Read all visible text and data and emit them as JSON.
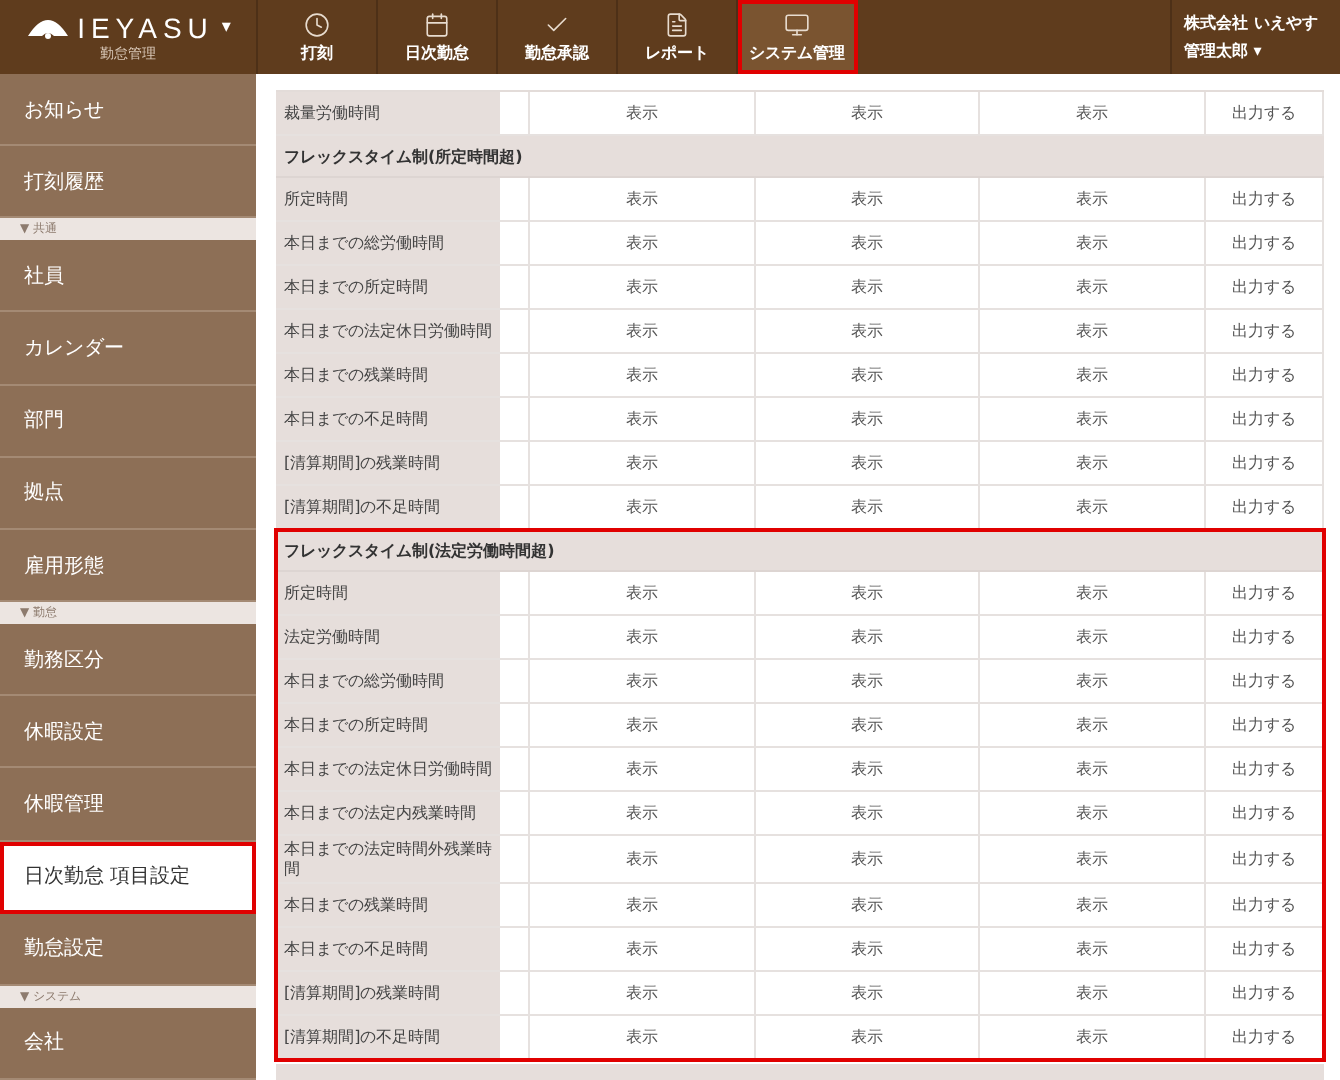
{
  "header": {
    "logo": "IEYASU",
    "logo_caret": "▾",
    "subtitle": "勤怠管理",
    "nav": [
      {
        "label": "打刻",
        "kind": "clock",
        "selected": false,
        "highlighted": false
      },
      {
        "label": "日次勤怠",
        "kind": "calendar",
        "selected": false,
        "highlighted": false
      },
      {
        "label": "勤怠承認",
        "kind": "check",
        "selected": false,
        "highlighted": false
      },
      {
        "label": "レポート",
        "kind": "document",
        "selected": false,
        "highlighted": false
      },
      {
        "label": "システム管理",
        "kind": "monitor",
        "selected": true,
        "highlighted": true
      }
    ],
    "company": "株式会社 いえやす",
    "user": "管理太郎",
    "user_caret": "▾"
  },
  "sidebar": {
    "items": [
      {
        "kind": "item",
        "label": "お知らせ",
        "selected": false,
        "highlighted": false
      },
      {
        "kind": "item",
        "label": "打刻履歴",
        "selected": false,
        "highlighted": false
      },
      {
        "kind": "group",
        "label": "▼ 共通"
      },
      {
        "kind": "item",
        "label": "社員",
        "selected": false,
        "highlighted": false
      },
      {
        "kind": "item",
        "label": "カレンダー",
        "selected": false,
        "highlighted": false
      },
      {
        "kind": "item",
        "label": "部門",
        "selected": false,
        "highlighted": false
      },
      {
        "kind": "item",
        "label": "拠点",
        "selected": false,
        "highlighted": false
      },
      {
        "kind": "item",
        "label": "雇用形態",
        "selected": false,
        "highlighted": false
      },
      {
        "kind": "group",
        "label": "▼ 勤怠"
      },
      {
        "kind": "item",
        "label": "勤務区分",
        "selected": false,
        "highlighted": false
      },
      {
        "kind": "item",
        "label": "休暇設定",
        "selected": false,
        "highlighted": false
      },
      {
        "kind": "item",
        "label": "休暇管理",
        "selected": false,
        "highlighted": false
      },
      {
        "kind": "item",
        "label": "日次勤怠 項目設定",
        "selected": true,
        "highlighted": true
      },
      {
        "kind": "item",
        "label": "勤怠設定",
        "selected": false,
        "highlighted": false
      },
      {
        "kind": "group",
        "label": "▼ システム"
      },
      {
        "kind": "item",
        "label": "会社",
        "selected": false,
        "highlighted": false
      }
    ]
  },
  "table": {
    "sections": [
      {
        "highlighted": false,
        "rows": [
          {
            "label": "裁量労働時間",
            "cells": [
              "表示",
              "表示",
              "表示",
              "出力する"
            ]
          }
        ]
      },
      {
        "heading": "フレックスタイム制(所定時間超)",
        "highlighted": false,
        "rows": [
          {
            "label": "所定時間",
            "cells": [
              "表示",
              "表示",
              "表示",
              "出力する"
            ]
          },
          {
            "label": "本日までの総労働時間",
            "cells": [
              "表示",
              "表示",
              "表示",
              "出力する"
            ]
          },
          {
            "label": "本日までの所定時間",
            "cells": [
              "表示",
              "表示",
              "表示",
              "出力する"
            ]
          },
          {
            "label": "本日までの法定休日労働時間",
            "cells": [
              "表示",
              "表示",
              "表示",
              "出力する"
            ]
          },
          {
            "label": "本日までの残業時間",
            "cells": [
              "表示",
              "表示",
              "表示",
              "出力する"
            ]
          },
          {
            "label": "本日までの不足時間",
            "cells": [
              "表示",
              "表示",
              "表示",
              "出力する"
            ]
          },
          {
            "label": "[清算期間]の残業時間",
            "cells": [
              "表示",
              "表示",
              "表示",
              "出力する"
            ]
          },
          {
            "label": "[清算期間]の不足時間",
            "cells": [
              "表示",
              "表示",
              "表示",
              "出力する"
            ]
          }
        ]
      },
      {
        "heading": "フレックスタイム制(法定労働時間超)",
        "highlighted": true,
        "rows": [
          {
            "label": "所定時間",
            "cells": [
              "表示",
              "表示",
              "表示",
              "出力する"
            ]
          },
          {
            "label": "法定労働時間",
            "cells": [
              "表示",
              "表示",
              "表示",
              "出力する"
            ]
          },
          {
            "label": "本日までの総労働時間",
            "cells": [
              "表示",
              "表示",
              "表示",
              "出力する"
            ]
          },
          {
            "label": "本日までの所定時間",
            "cells": [
              "表示",
              "表示",
              "表示",
              "出力する"
            ]
          },
          {
            "label": "本日までの法定休日労働時間",
            "cells": [
              "表示",
              "表示",
              "表示",
              "出力する"
            ]
          },
          {
            "label": "本日までの法定内残業時間",
            "cells": [
              "表示",
              "表示",
              "表示",
              "出力する"
            ]
          },
          {
            "label": "本日までの法定時間外残業時間",
            "cells": [
              "表示",
              "表示",
              "表示",
              "出力する"
            ]
          },
          {
            "label": "本日までの残業時間",
            "cells": [
              "表示",
              "表示",
              "表示",
              "出力する"
            ]
          },
          {
            "label": "本日までの不足時間",
            "cells": [
              "表示",
              "表示",
              "表示",
              "出力する"
            ]
          },
          {
            "label": "[清算期間]の残業時間",
            "cells": [
              "表示",
              "表示",
              "表示",
              "出力する"
            ]
          },
          {
            "label": "[清算期間]の不足時間",
            "cells": [
              "表示",
              "表示",
              "表示",
              "出力する"
            ]
          }
        ]
      }
    ]
  }
}
